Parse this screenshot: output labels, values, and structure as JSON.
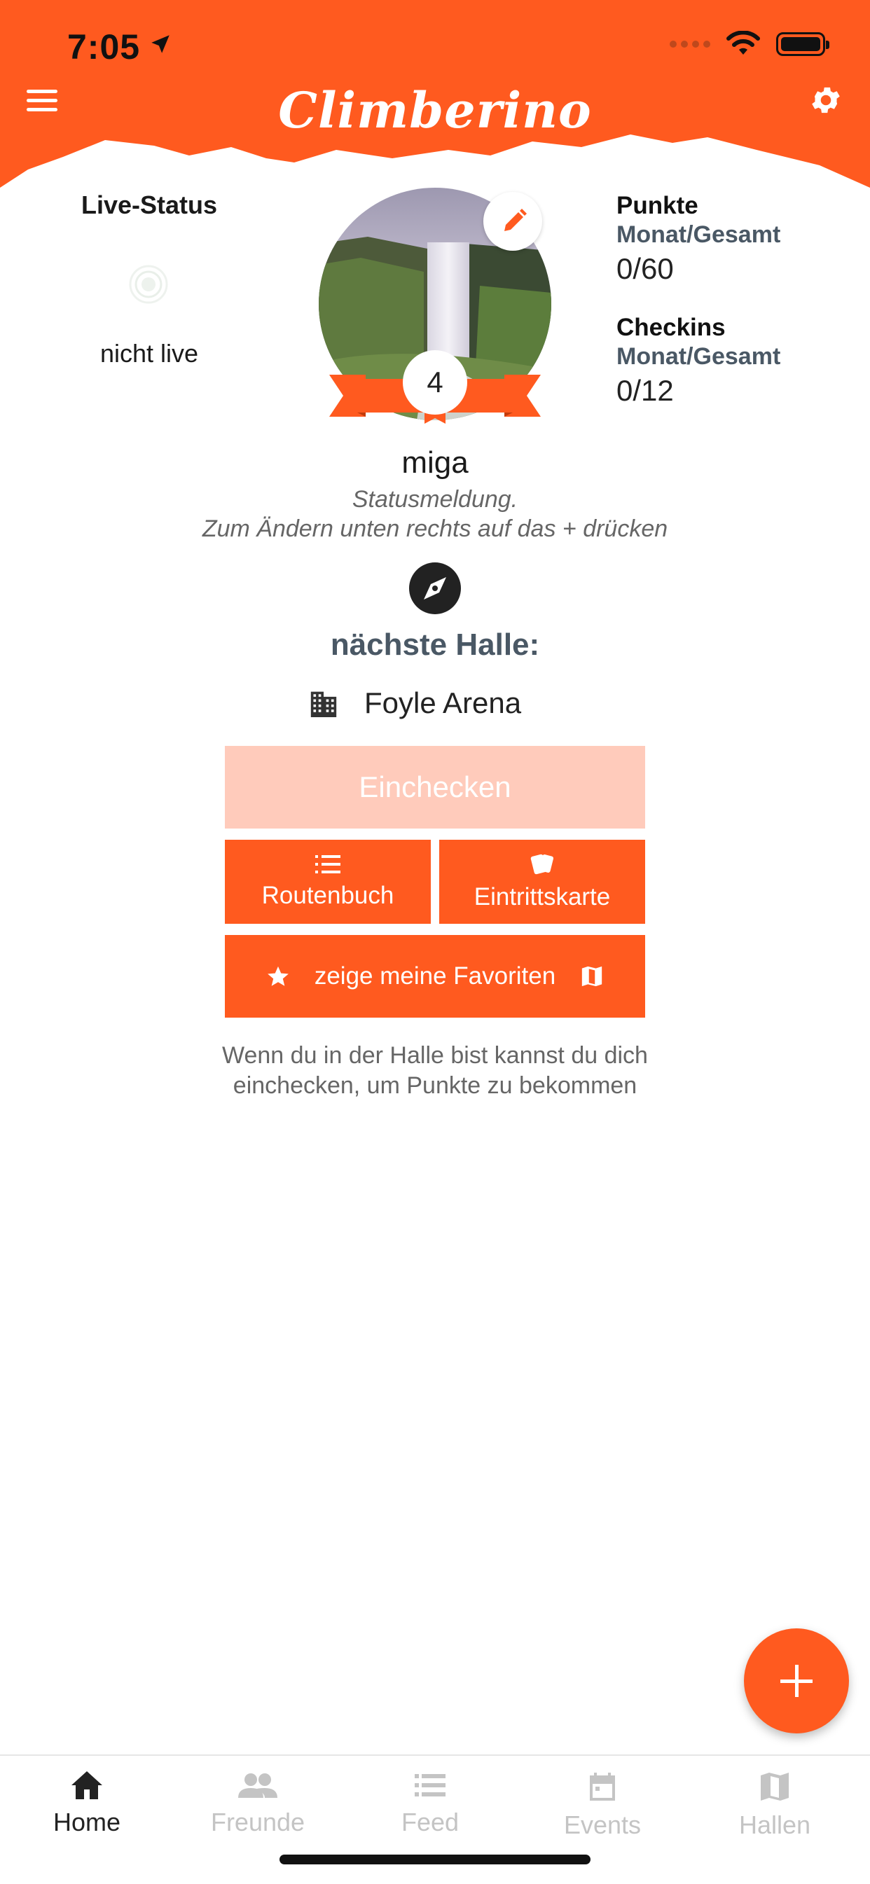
{
  "status_bar": {
    "time": "7:05"
  },
  "header": {
    "title": "Climberino"
  },
  "colors": {
    "accent": "#ff5a1f",
    "disabled_accent": "#ffcbbb",
    "muted_tab": "#c4c4c4",
    "slate": "#4a5865"
  },
  "live_status": {
    "title": "Live-Status",
    "state": "nicht live"
  },
  "profile": {
    "level": "4",
    "username": "miga",
    "status_line1": "Statusmeldung.",
    "status_line2": "Zum Ändern unten rechts auf das + drücken"
  },
  "stats": {
    "points_title": "Punkte",
    "points_sub": "Monat/Gesamt",
    "points_value": "0/60",
    "checkins_title": "Checkins",
    "checkins_sub": "Monat/Gesamt",
    "checkins_value": "0/12"
  },
  "hall": {
    "label": "nächste Halle:",
    "name": "Foyle Arena"
  },
  "buttons": {
    "checkin": "Einchecken",
    "routebook": "Routenbuch",
    "ticket": "Eintrittskarte",
    "favorites": "zeige meine Favoriten"
  },
  "hint": "Wenn du in der Halle bist kannst du dich einchecken, um Punkte zu bekommen",
  "tabs": [
    {
      "label": "Home",
      "icon": "home-icon",
      "active": true
    },
    {
      "label": "Freunde",
      "icon": "people-icon",
      "active": false
    },
    {
      "label": "Feed",
      "icon": "list-icon",
      "active": false
    },
    {
      "label": "Events",
      "icon": "calendar-icon",
      "active": false
    },
    {
      "label": "Hallen",
      "icon": "map-icon",
      "active": false
    }
  ]
}
